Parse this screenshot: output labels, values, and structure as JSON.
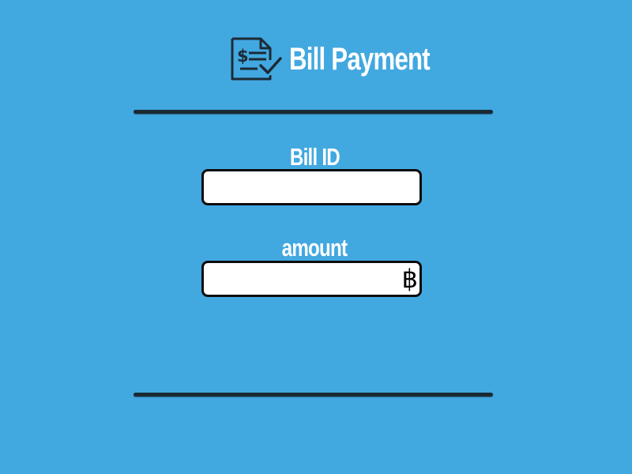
{
  "app": {
    "title": "Bill Payment"
  },
  "form": {
    "bill_id": {
      "label": "Bill ID",
      "value": "",
      "placeholder": ""
    },
    "amount": {
      "label": "amount",
      "value": "",
      "placeholder": "",
      "currency_symbol": "฿"
    }
  },
  "colors": {
    "background": "#42a8e0",
    "text": "#ffffff",
    "divider": "#1a2a33",
    "input_border": "#0d0d0d",
    "input_background": "#ffffff"
  },
  "icons": {
    "header": "bill-check-icon"
  }
}
